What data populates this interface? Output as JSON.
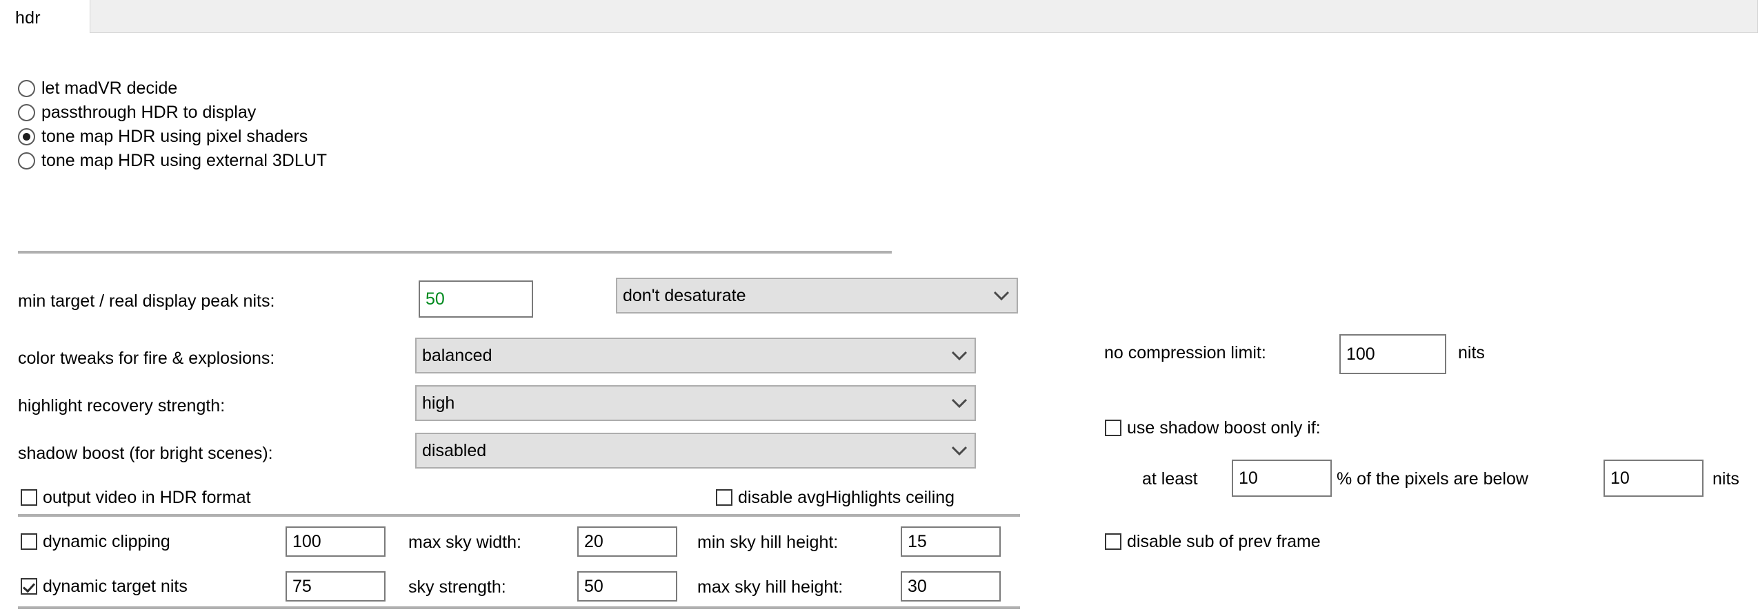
{
  "tabs": {
    "active_label": "hdr"
  },
  "hdr_mode": {
    "options": [
      {
        "label": "let madVR decide",
        "checked": false
      },
      {
        "label": "passthrough HDR to display",
        "checked": false
      },
      {
        "label": "tone map HDR using pixel shaders",
        "checked": true
      },
      {
        "label": "tone map HDR using external 3DLUT",
        "checked": false
      }
    ]
  },
  "settings": {
    "min_target_label": "min target / real display peak nits:",
    "min_target_value": "50",
    "desaturate_value": "don't desaturate",
    "color_tweaks_label": "color tweaks for fire & explosions:",
    "color_tweaks_value": "balanced",
    "highlight_recovery_label": "highlight recovery strength:",
    "highlight_recovery_value": "high",
    "shadow_boost_label": "shadow boost (for bright scenes):",
    "shadow_boost_value": "disabled"
  },
  "checkboxes": {
    "output_hdr_label": "output video in HDR format",
    "output_hdr_checked": false,
    "disable_avg_label": "disable avgHighlights ceiling",
    "disable_avg_checked": false,
    "dynamic_clipping_label": "dynamic clipping",
    "dynamic_clipping_checked": false,
    "dynamic_target_label": "dynamic target nits",
    "dynamic_target_checked": true,
    "use_shadow_boost_label": "use shadow boost only if:",
    "use_shadow_boost_checked": false,
    "disable_sub_label": "disable sub of prev frame",
    "disable_sub_checked": false
  },
  "sky": {
    "dynamic_clipping_value": "100",
    "dynamic_target_value": "75",
    "max_sky_width_label": "max sky width:",
    "max_sky_width_value": "20",
    "sky_strength_label": "sky strength:",
    "sky_strength_value": "50",
    "min_sky_hill_label": "min sky hill height:",
    "min_sky_hill_value": "15",
    "max_sky_hill_label": "max sky hill height:",
    "max_sky_hill_value": "30"
  },
  "right": {
    "no_compression_label": "no compression limit:",
    "no_compression_value": "100",
    "no_compression_unit": "nits",
    "at_least_label": "at least",
    "at_least_value": "10",
    "percent_label": "% of the pixels are below",
    "below_value": "10",
    "below_unit": "nits"
  },
  "colors": {
    "tab_active_bg": "#ffffff",
    "tab_inactive_bg": "#efefef",
    "combo_bg": "#e1e1e1",
    "edit_border": "#7a7a7a",
    "green_text": "#008a1e"
  }
}
